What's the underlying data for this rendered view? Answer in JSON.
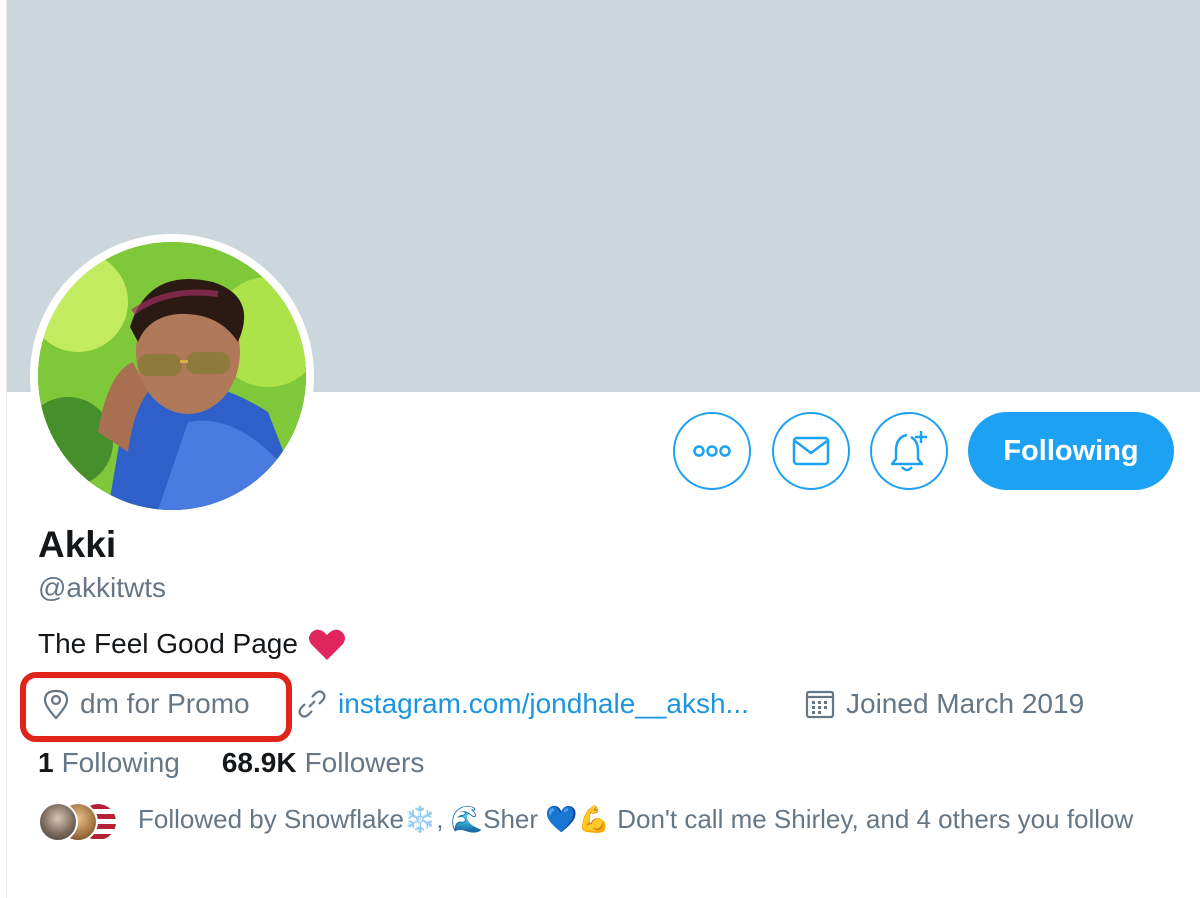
{
  "profile": {
    "name": "Akki",
    "handle": "@akkitwts",
    "bio": "The Feel Good Page",
    "location": "dm for Promo",
    "website": "instagram.com/jondhale__aksh...",
    "joined": "Joined March 2019"
  },
  "actions": {
    "following_label": "Following"
  },
  "stats": {
    "following_count": "1",
    "following_label": "Following",
    "followers_count": "68.9K",
    "followers_label": "Followers"
  },
  "followed_by": {
    "text": "Followed by Snowflake❄️, 🌊Sher 💙💪 Don't call me Shirley, and 4 others you follow"
  },
  "colors": {
    "accent": "#1da1f2",
    "link": "#1b95e0",
    "banner": "#ccd6dd",
    "secondary_text": "#657786",
    "highlight_box": "#e0231b",
    "heart": "#e0245e"
  },
  "icons": [
    "more-icon",
    "mail-icon",
    "bell-plus-icon",
    "location-pin-icon",
    "link-icon",
    "calendar-icon",
    "heart-icon"
  ]
}
